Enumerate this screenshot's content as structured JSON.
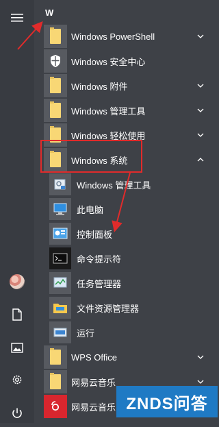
{
  "letter": "W",
  "items": [
    {
      "label": "Windows PowerShell",
      "icon": "folder-icon",
      "chevron": "down"
    },
    {
      "label": "Windows 安全中心",
      "icon": "shield-icon",
      "chevron": ""
    },
    {
      "label": "Windows 附件",
      "icon": "folder-icon",
      "chevron": "down"
    },
    {
      "label": "Windows 管理工具",
      "icon": "folder-icon",
      "chevron": "down"
    },
    {
      "label": "Windows 轻松使用",
      "icon": "folder-icon",
      "chevron": "down"
    },
    {
      "label": "Windows 系统",
      "icon": "folder-icon",
      "chevron": "up"
    },
    {
      "label": "Windows 管理工具",
      "icon": "admin-tools-icon",
      "sub": true
    },
    {
      "label": "此电脑",
      "icon": "computer-icon",
      "sub": true
    },
    {
      "label": "控制面板",
      "icon": "control-panel-icon",
      "sub": true
    },
    {
      "label": "命令提示符",
      "icon": "command-prompt-icon",
      "sub": true
    },
    {
      "label": "任务管理器",
      "icon": "task-manager-icon",
      "sub": true
    },
    {
      "label": "文件资源管理器",
      "icon": "file-explorer-icon",
      "sub": true
    },
    {
      "label": "运行",
      "icon": "run-icon",
      "sub": true
    },
    {
      "label": "WPS Office",
      "icon": "folder-icon",
      "chevron": "down"
    },
    {
      "label": "网易云音乐",
      "icon": "folder-icon",
      "chevron": "down"
    },
    {
      "label": "网易云音乐",
      "icon": "netease-music-icon",
      "chevron": ""
    }
  ],
  "rail": [
    "menu-icon",
    "avatar",
    "document-icon",
    "pictures-icon",
    "settings-icon",
    "power-icon"
  ],
  "watermark": "ZNDS问答",
  "colors": {
    "highlight": "#e12b2b",
    "folder": "#f8d775",
    "background": "#3e4147"
  }
}
